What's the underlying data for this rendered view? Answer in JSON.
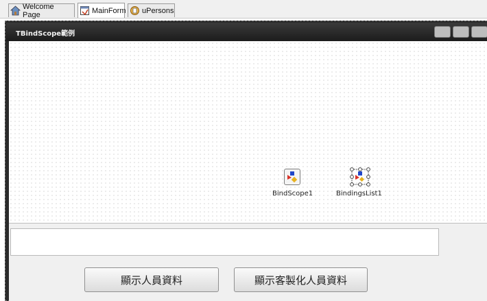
{
  "tabs": [
    {
      "label": "Welcome Page",
      "icon": "house-icon",
      "active": false
    },
    {
      "label": "MainForm",
      "icon": "form-icon",
      "active": true
    },
    {
      "label": "uPersons",
      "icon": "unit-icon",
      "active": false
    }
  ],
  "form": {
    "title": "TBindScope範例"
  },
  "components": {
    "bindscope": {
      "label": "BindScope1",
      "icon": "bindscope-icon"
    },
    "bindingslist": {
      "label": "BindingsList1",
      "icon": "bindingslist-icon"
    }
  },
  "memo": {
    "value": ""
  },
  "buttons": {
    "show_persons": "顯示人員資料",
    "show_custom_persons": "顯示客製化人員資料"
  }
}
